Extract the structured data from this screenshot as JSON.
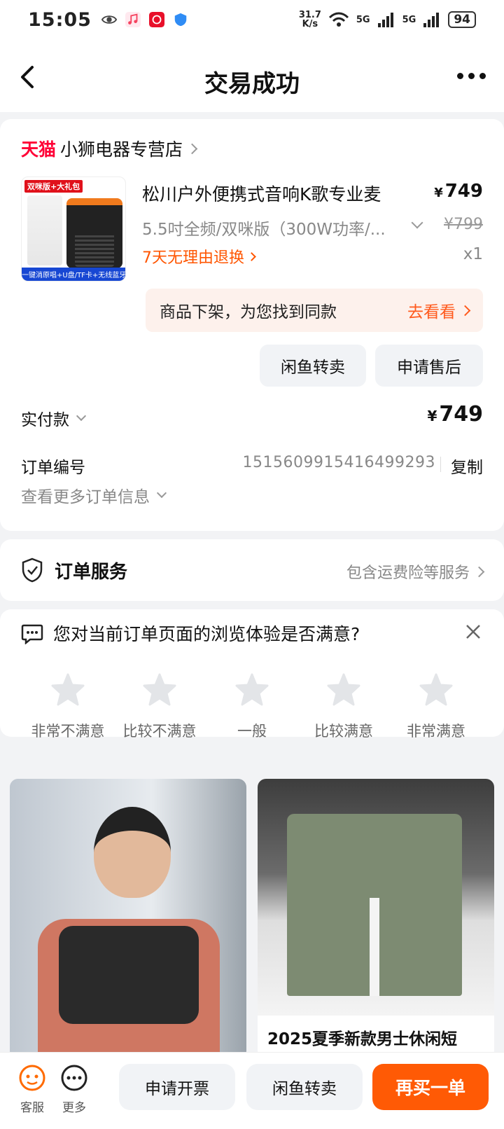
{
  "status_bar": {
    "time": "15:05",
    "net_speed_value": "31.7",
    "net_speed_unit": "K/s",
    "network_1": "5G",
    "network_2": "5G",
    "battery": "94"
  },
  "nav": {
    "title": "交易成功"
  },
  "order": {
    "store_badge": "天猫",
    "store_name": "小狮电器专营店",
    "thumb_top": "双咪版+大礼包",
    "thumb_bottom": "一键消原唱+U盘/TF卡+无线蓝牙",
    "product_title": "松川户外便携式音响K歌专业麦",
    "currency": "¥",
    "price": "749",
    "spec": "5.5吋全频/双咪版（300W功率/...",
    "original_price": "¥799",
    "return_policy": "7天无理由退换",
    "quantity": "x1",
    "notice_text": "商品下架，为您找到同款",
    "notice_link": "去看看",
    "btn_resell": "闲鱼转卖",
    "btn_aftersale": "申请售后",
    "paid_label": "实付款",
    "paid_amount": "749",
    "order_no_label": "订单编号",
    "order_no": "1515609915416499293",
    "copy": "复制",
    "more_info": "查看更多订单信息"
  },
  "service": {
    "title": "订单服务",
    "desc": "包含运费险等服务"
  },
  "survey": {
    "question": "您对当前订单页面的浏览体验是否满意?",
    "options": [
      "非常不满意",
      "比较不满意",
      "一般",
      "比较满意",
      "非常满意"
    ]
  },
  "feed": {
    "right_title": "2025夏季新款男士休闲短"
  },
  "tabbar": {
    "service_label": "客服",
    "more_label": "更多",
    "invoice": "申请开票",
    "resell": "闲鱼转卖",
    "buy_again": "再买一单"
  },
  "colors": {
    "accent": "#ff5a05",
    "tmall_red": "#ff0036",
    "notice_bg": "#fdf1ec"
  }
}
